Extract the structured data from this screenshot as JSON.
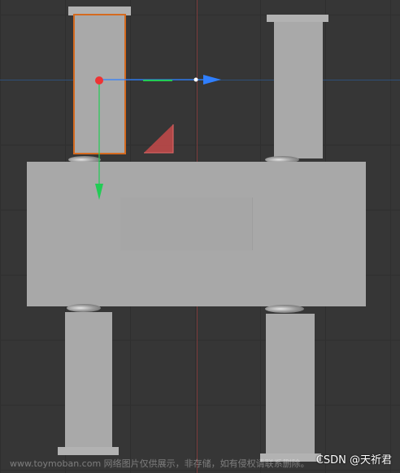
{
  "viewport": {
    "name": "3d-viewport",
    "background_color": "#363636",
    "selection_color": "#d46a1f"
  },
  "gizmo": {
    "x_axis_color": "#2f7fff",
    "y_axis_color": "#22cc55",
    "origin_color": "#ee3333"
  },
  "watermark": {
    "text": "www.toymoban.com 网络图片仅供展示，非存储，如有侵权请联系删除。",
    "credit": "CSDN @天祈君"
  }
}
